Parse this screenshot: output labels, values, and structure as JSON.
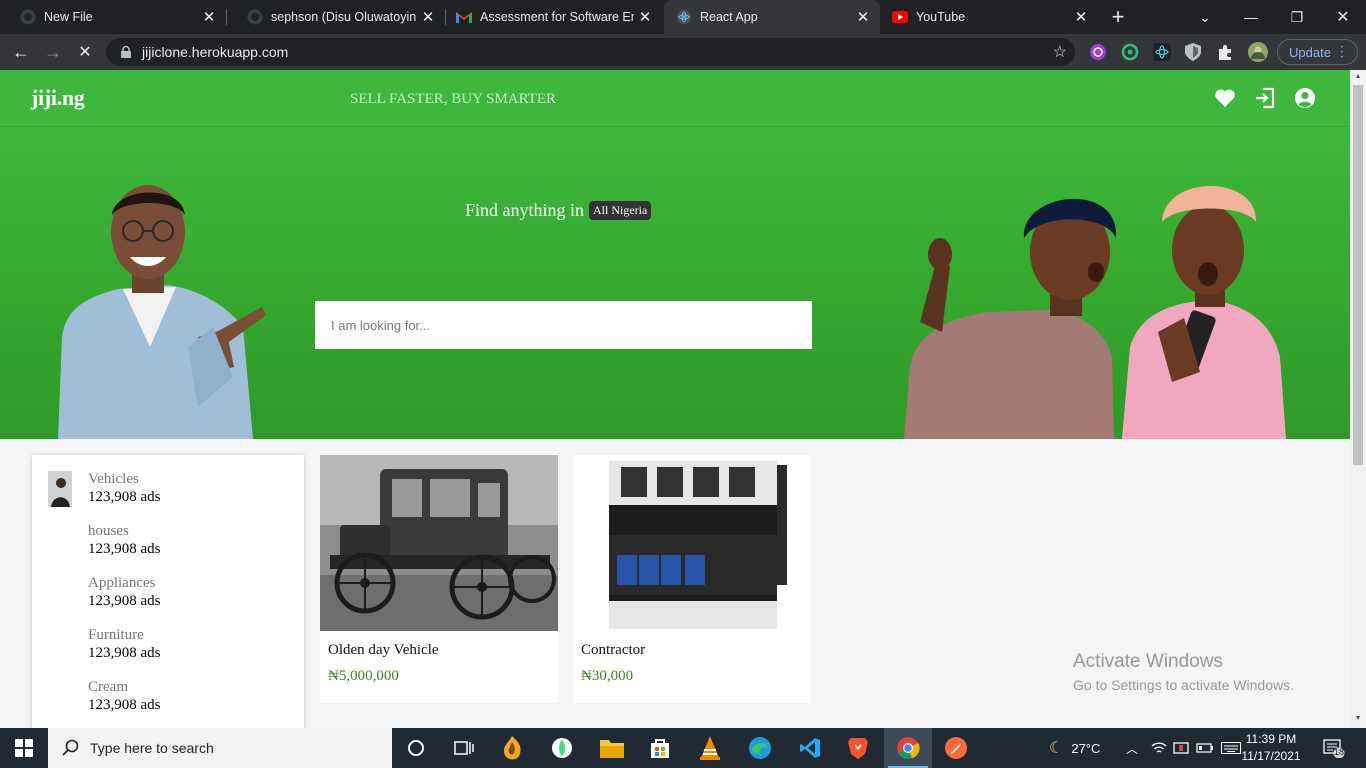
{
  "browser": {
    "tabs": [
      {
        "title": "New File",
        "icon": "github-icon",
        "active": false
      },
      {
        "title": "sephson (Disu Oluwatoyin Jo",
        "icon": "github-icon",
        "active": false
      },
      {
        "title": "Assessment for Software Eng",
        "icon": "gmail-icon",
        "active": false
      },
      {
        "title": "React App",
        "icon": "react-icon",
        "active": true
      },
      {
        "title": "YouTube",
        "icon": "youtube-icon",
        "active": false
      }
    ],
    "new_tab_symbol": "+",
    "url": "jijiclone.herokuapp.com",
    "update_label": "Update"
  },
  "site": {
    "logo": "jiji.ng",
    "tagline": "SELL FASTER, BUY SMARTER",
    "header_icons": [
      "heart-icon",
      "sign-in-icon",
      "user-circle-icon"
    ],
    "brand_color": "#3db83a"
  },
  "hero": {
    "find_text": "Find anything in",
    "location": "All Nigeria",
    "search_placeholder": "I am looking for..."
  },
  "categories": [
    {
      "name": "Vehicles",
      "count": "123,908 ads"
    },
    {
      "name": "houses",
      "count": "123,908 ads"
    },
    {
      "name": "Appliances",
      "count": "123,908 ads"
    },
    {
      "name": "Furniture",
      "count": "123,908 ads"
    },
    {
      "name": "Cream",
      "count": "123,908 ads"
    }
  ],
  "listings": [
    {
      "title": "Olden day Vehicle",
      "price": "₦5,000,000"
    },
    {
      "title": "Contractor",
      "price": "₦30,000"
    }
  ],
  "watermark": {
    "line1": "Activate Windows",
    "line2": "Go to Settings to activate Windows."
  },
  "taskbar": {
    "search_placeholder": "Type here to search",
    "weather": "27°C",
    "time": "11:39 PM",
    "date": "11/17/2021",
    "notification_count": "18",
    "apps": [
      "task-view-icon",
      "widgets-icon",
      "fl-studio-icon",
      "android-studio-icon",
      "file-explorer-icon",
      "store-icon",
      "vlc-icon",
      "edge-icon",
      "vscode-icon",
      "brave-icon",
      "chrome-icon",
      "postman-icon"
    ]
  }
}
